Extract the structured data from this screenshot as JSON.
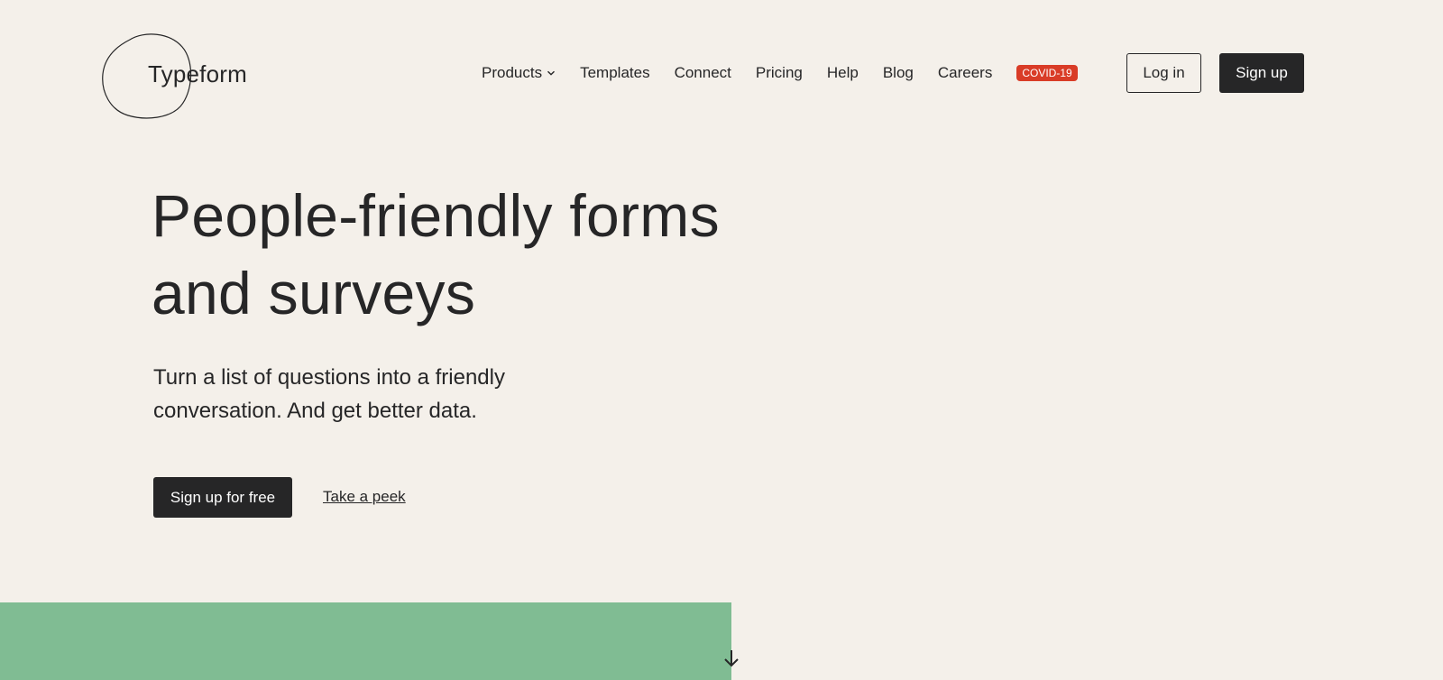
{
  "logo": {
    "text": "Typeform"
  },
  "nav": {
    "items": [
      {
        "label": "Products",
        "has_dropdown": true
      },
      {
        "label": "Templates"
      },
      {
        "label": "Connect"
      },
      {
        "label": "Pricing"
      },
      {
        "label": "Help"
      },
      {
        "label": "Blog"
      },
      {
        "label": "Careers"
      }
    ],
    "badge": {
      "label": "COVID-19",
      "color": "#d93c27"
    }
  },
  "header": {
    "login_label": "Log in",
    "signup_label": "Sign up"
  },
  "hero": {
    "title_line1": "People-friendly forms",
    "title_line2": "and surveys",
    "subtitle_line1": "Turn a list of questions into a friendly",
    "subtitle_line2": "conversation. And get better data.",
    "cta_primary": "Sign up for free",
    "cta_secondary": "Take a peek"
  },
  "colors": {
    "background": "#f4f0ea",
    "text": "#262627",
    "primary_button": "#262627",
    "accent_green": "#80bc93",
    "badge_red": "#d93c27"
  },
  "icons": {
    "dropdown": "chevron-down-icon",
    "scroll": "arrow-down-icon",
    "logo_shape": "blob-outline"
  }
}
